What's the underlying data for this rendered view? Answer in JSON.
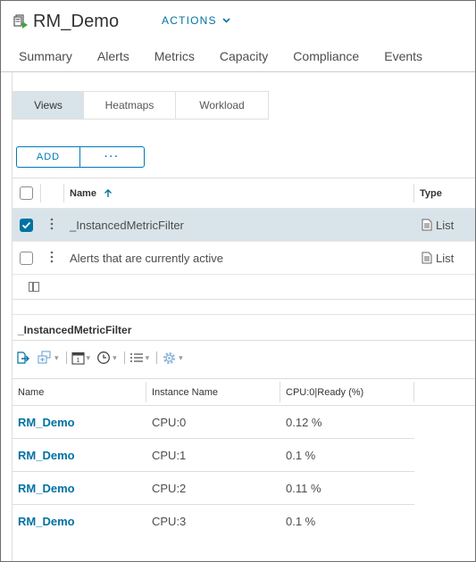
{
  "header": {
    "title": "RM_Demo",
    "actions_label": "ACTIONS"
  },
  "tabs": [
    {
      "label": "Summary"
    },
    {
      "label": "Alerts"
    },
    {
      "label": "Metrics"
    },
    {
      "label": "Capacity"
    },
    {
      "label": "Compliance"
    },
    {
      "label": "Events"
    }
  ],
  "view_switch": [
    {
      "label": "Views",
      "active": true
    },
    {
      "label": "Heatmaps",
      "active": false
    },
    {
      "label": "Workload",
      "active": false
    }
  ],
  "toolbar_buttons": {
    "add_label": "ADD",
    "more_label": "···"
  },
  "views_grid": {
    "columns": {
      "name": "Name",
      "sort_icon": "arrow-up-icon",
      "type": "Type"
    },
    "rows": [
      {
        "name": "_InstancedMetricFilter",
        "type": "List",
        "selected": true
      },
      {
        "name": "Alerts that are currently active",
        "type": "List",
        "selected": false
      }
    ]
  },
  "detail": {
    "title": "_InstancedMetricFilter",
    "toolbar_icons": [
      "export-icon",
      "add-dashboard-icon",
      "calendar-icon",
      "clock-icon",
      "list-icon",
      "gear-icon"
    ],
    "columns": {
      "name": "Name",
      "instance": "Instance Name",
      "cpu": "CPU:0|Ready (%)"
    },
    "rows": [
      {
        "name": "RM_Demo",
        "instance": "CPU:0",
        "cpu": "0.12 %"
      },
      {
        "name": "RM_Demo",
        "instance": "CPU:1",
        "cpu": "0.1 %"
      },
      {
        "name": "RM_Demo",
        "instance": "CPU:2",
        "cpu": "0.11 %"
      },
      {
        "name": "RM_Demo",
        "instance": "CPU:3",
        "cpu": "0.1 %"
      }
    ]
  },
  "colors": {
    "accent": "#0072a3",
    "selected_row": "#d9e4ea"
  }
}
